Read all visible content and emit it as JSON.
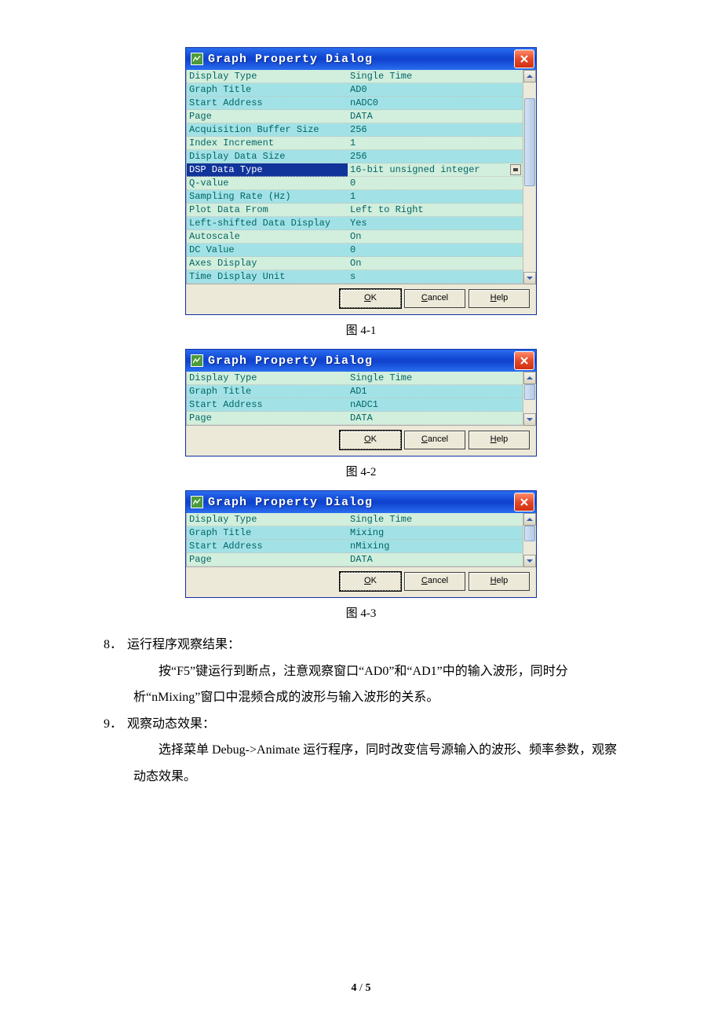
{
  "dialog1": {
    "title": "Graph Property Dialog",
    "rows": [
      {
        "k": "Display Type",
        "v": "Single Time"
      },
      {
        "k": "Graph Title",
        "v": "AD0"
      },
      {
        "k": "Start Address",
        "v": "nADC0"
      },
      {
        "k": "Page",
        "v": "DATA"
      },
      {
        "k": "Acquisition Buffer Size",
        "v": "256"
      },
      {
        "k": "Index Increment",
        "v": "1"
      },
      {
        "k": "Display Data Size",
        "v": "256"
      },
      {
        "k": "DSP Data Type",
        "v": "16-bit unsigned integer"
      },
      {
        "k": "Q-value",
        "v": "0"
      },
      {
        "k": "Sampling Rate (Hz)",
        "v": "1"
      },
      {
        "k": "Plot Data From",
        "v": "Left to Right"
      },
      {
        "k": "Left-shifted Data Display",
        "v": "Yes"
      },
      {
        "k": "Autoscale",
        "v": "On"
      },
      {
        "k": "DC Value",
        "v": "0"
      },
      {
        "k": "Axes Display",
        "v": "On"
      },
      {
        "k": "Time Display Unit",
        "v": "s"
      }
    ],
    "buttons": {
      "ok": "OK",
      "cancel": "Cancel",
      "help": "Help"
    }
  },
  "caption1": "图 4-1",
  "dialog2": {
    "title": "Graph Property Dialog",
    "rows": [
      {
        "k": "Display Type",
        "v": "Single Time"
      },
      {
        "k": "Graph Title",
        "v": "AD1"
      },
      {
        "k": "Start Address",
        "v": "nADC1"
      },
      {
        "k": "Page",
        "v": "DATA"
      }
    ],
    "buttons": {
      "ok": "OK",
      "cancel": "Cancel",
      "help": "Help"
    }
  },
  "caption2": "图 4-2",
  "dialog3": {
    "title": "Graph Property Dialog",
    "rows": [
      {
        "k": "Display Type",
        "v": "Single Time"
      },
      {
        "k": "Graph Title",
        "v": "Mixing"
      },
      {
        "k": "Start Address",
        "v": "nMixing"
      },
      {
        "k": "Page",
        "v": "DATA"
      }
    ],
    "buttons": {
      "ok": "OK",
      "cancel": "Cancel",
      "help": "Help"
    }
  },
  "caption3": "图 4-3",
  "text": {
    "i8_num": "8．",
    "i8_title": "运行程序观察结果：",
    "i8_para": "按“F5”键运行到断点，注意观察窗口“AD0”和“AD1”中的输入波形，同时分析“nMixing”窗口中混频合成的波形与输入波形的关系。",
    "i9_num": "9．",
    "i9_title": "观察动态效果：",
    "i9_para": "选择菜单 Debug->Animate 运行程序，同时改变信号源输入的波形、频率参数，观察动态效果。"
  },
  "pagenum": {
    "cur": "4",
    "sep": " / ",
    "tot": "5"
  }
}
